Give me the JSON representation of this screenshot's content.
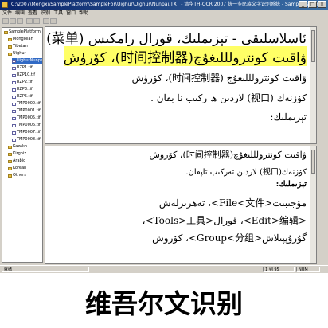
{
  "window": {
    "title": "C:\\2007\\Mengxi\\SamplePlatform\\SampleFor\\Uighur\\Uighur\\Nunpai.TXT - 清华TH-OCR 2007 统一多民族文字识别系统 - SamplePlatform",
    "buttons": [
      "_",
      "□",
      "×"
    ]
  },
  "menu": [
    "文件",
    "编辑",
    "查看",
    "识别",
    "工具",
    "窗口",
    "帮助"
  ],
  "tree": [
    {
      "label": "SamplePlatform",
      "indent": 0,
      "type": "folder"
    },
    {
      "label": "Mongolian",
      "indent": 1,
      "type": "folder"
    },
    {
      "label": "Tibetan",
      "indent": 1,
      "type": "folder"
    },
    {
      "label": "Uighur",
      "indent": 1,
      "type": "folder"
    },
    {
      "label": "UighurNunpai.tif",
      "indent": 2,
      "type": "file",
      "selected": true
    },
    {
      "label": "RZP1.tif",
      "indent": 2,
      "type": "file"
    },
    {
      "label": "RZP10.tif",
      "indent": 2,
      "type": "file"
    },
    {
      "label": "RZP2.tif",
      "indent": 2,
      "type": "file"
    },
    {
      "label": "RZP3.tif",
      "indent": 2,
      "type": "file"
    },
    {
      "label": "RZP5.tif",
      "indent": 2,
      "type": "file"
    },
    {
      "label": "TMP0000.tif",
      "indent": 2,
      "type": "file"
    },
    {
      "label": "TMP0001.tif",
      "indent": 2,
      "type": "file"
    },
    {
      "label": "TMP0005.tif",
      "indent": 2,
      "type": "file"
    },
    {
      "label": "TMP0006.tif",
      "indent": 2,
      "type": "file"
    },
    {
      "label": "TMP0007.tif",
      "indent": 2,
      "type": "file"
    },
    {
      "label": "TMP0008.tif",
      "indent": 2,
      "type": "file"
    },
    {
      "label": "Kazakh",
      "indent": 1,
      "type": "folder"
    },
    {
      "label": "Kirghiz",
      "indent": 1,
      "type": "folder"
    },
    {
      "label": "Arabic",
      "indent": 1,
      "type": "folder"
    },
    {
      "label": "Korean",
      "indent": 1,
      "type": "folder"
    },
    {
      "label": "Others",
      "indent": 1,
      "type": "folder"
    }
  ],
  "image_pane": {
    "lines": [
      "ئاسلاسلىقى - تېزىملىك، قورال رامكىس (菜单)",
      "ۋاقىت كونترولللىغۇچ(时间控制器)، كۆرۈش",
      "ۋاقىت كونترولللىغۇچ (时间控制器)، كۆرۈش",
      "كۆزنەك (视口) لاردىن ھ ركىب نا بقان .",
      "تېزىملىك:"
    ]
  },
  "text_pane": {
    "lines": [
      "ۋاقىت كونترولللىغۇچ(时间控制器)، كۆرۈش",
      "كۆزنەك(视口) لاردىن تەركىب تاپقان.",
      "تېزىملىك:",
      "مۆجىبىت<File<文件>، تەھرىرلەش",
      "<Edit>编辑>، قورال<Tools>工具>،",
      "گۇرۇپپىلاش<Group<分组>، كۆرۈش"
    ]
  },
  "status": {
    "left": "就绪",
    "position": "1 列 95",
    "right": "NUM"
  },
  "caption": "维吾尔文识别"
}
